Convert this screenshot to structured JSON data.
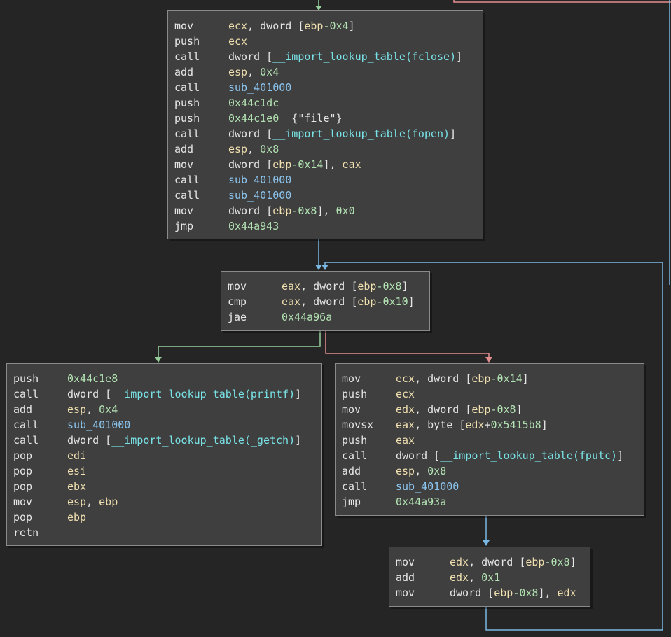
{
  "colors": {
    "background": "#252525",
    "block_bg": "#3f3f3f",
    "block_border": "#8a8a8a",
    "edge_unconditional": "#7ab8e4",
    "edge_true": "#97d09d",
    "edge_false": "#e48f8f",
    "register": "#f0dfaf",
    "number": "#b3e3b3",
    "symbol": "#79e2e6",
    "subroutine": "#8cc6f0"
  },
  "blocks": [
    {
      "id": "block_file_setup",
      "lines": [
        {
          "mnemonic": "mov",
          "operands": [
            [
              "ecx",
              "reg"
            ],
            [
              ", dword [",
              "txt"
            ],
            [
              "ebp",
              "reg"
            ],
            [
              "-0x4",
              "num"
            ],
            [
              "]",
              "txt"
            ]
          ]
        },
        {
          "mnemonic": "push",
          "operands": [
            [
              "ecx",
              "reg"
            ]
          ]
        },
        {
          "mnemonic": "call",
          "operands": [
            [
              "dword [",
              "txt"
            ],
            [
              "__import_lookup_table(fclose)",
              "sym"
            ],
            [
              "]",
              "txt"
            ]
          ]
        },
        {
          "mnemonic": "add",
          "operands": [
            [
              "esp",
              "reg"
            ],
            [
              ", ",
              "txt"
            ],
            [
              "0x4",
              "num"
            ]
          ]
        },
        {
          "mnemonic": "call",
          "operands": [
            [
              "sub_401000",
              "sub"
            ]
          ]
        },
        {
          "mnemonic": "push",
          "operands": [
            [
              "0x44c1dc",
              "num"
            ]
          ]
        },
        {
          "mnemonic": "push",
          "operands": [
            [
              "0x44c1e0",
              "num"
            ],
            [
              "  {\"file\"}",
              "txt"
            ]
          ]
        },
        {
          "mnemonic": "call",
          "operands": [
            [
              "dword [",
              "txt"
            ],
            [
              "__import_lookup_table(fopen)",
              "sym"
            ],
            [
              "]",
              "txt"
            ]
          ]
        },
        {
          "mnemonic": "add",
          "operands": [
            [
              "esp",
              "reg"
            ],
            [
              ", ",
              "txt"
            ],
            [
              "0x8",
              "num"
            ]
          ]
        },
        {
          "mnemonic": "mov",
          "operands": [
            [
              "dword [",
              "txt"
            ],
            [
              "ebp",
              "reg"
            ],
            [
              "-0x14",
              "num"
            ],
            [
              "], ",
              "txt"
            ],
            [
              "eax",
              "reg"
            ]
          ]
        },
        {
          "mnemonic": "call",
          "operands": [
            [
              "sub_401000",
              "sub"
            ]
          ]
        },
        {
          "mnemonic": "call",
          "operands": [
            [
              "sub_401000",
              "sub"
            ]
          ]
        },
        {
          "mnemonic": "mov",
          "operands": [
            [
              "dword [",
              "txt"
            ],
            [
              "ebp",
              "reg"
            ],
            [
              "-0x8",
              "num"
            ],
            [
              "], ",
              "txt"
            ],
            [
              "0x0",
              "num"
            ]
          ]
        },
        {
          "mnemonic": "jmp",
          "operands": [
            [
              "0x44a943",
              "num"
            ]
          ]
        }
      ]
    },
    {
      "id": "block_loop_cond",
      "lines": [
        {
          "mnemonic": "mov",
          "operands": [
            [
              "eax",
              "reg"
            ],
            [
              ", dword [",
              "txt"
            ],
            [
              "ebp",
              "reg"
            ],
            [
              "-0x8",
              "num"
            ],
            [
              "]",
              "txt"
            ]
          ]
        },
        {
          "mnemonic": "cmp",
          "operands": [
            [
              "eax",
              "reg"
            ],
            [
              ", dword [",
              "txt"
            ],
            [
              "ebp",
              "reg"
            ],
            [
              "-0x10",
              "num"
            ],
            [
              "]",
              "txt"
            ]
          ]
        },
        {
          "mnemonic": "jae",
          "operands": [
            [
              "0x44a96a",
              "num"
            ]
          ]
        }
      ]
    },
    {
      "id": "block_exit",
      "lines": [
        {
          "mnemonic": "push",
          "operands": [
            [
              "0x44c1e8",
              "num"
            ]
          ]
        },
        {
          "mnemonic": "call",
          "operands": [
            [
              "dword [",
              "txt"
            ],
            [
              "__import_lookup_table(printf)",
              "sym"
            ],
            [
              "]",
              "txt"
            ]
          ]
        },
        {
          "mnemonic": "add",
          "operands": [
            [
              "esp",
              "reg"
            ],
            [
              ", ",
              "txt"
            ],
            [
              "0x4",
              "num"
            ]
          ]
        },
        {
          "mnemonic": "call",
          "operands": [
            [
              "sub_401000",
              "sub"
            ]
          ]
        },
        {
          "mnemonic": "call",
          "operands": [
            [
              "dword [",
              "txt"
            ],
            [
              "__import_lookup_table(_getch)",
              "sym"
            ],
            [
              "]",
              "txt"
            ]
          ]
        },
        {
          "mnemonic": "pop",
          "operands": [
            [
              "edi",
              "reg"
            ]
          ]
        },
        {
          "mnemonic": "pop",
          "operands": [
            [
              "esi",
              "reg"
            ]
          ]
        },
        {
          "mnemonic": "pop",
          "operands": [
            [
              "ebx",
              "reg"
            ]
          ]
        },
        {
          "mnemonic": "mov",
          "operands": [
            [
              "esp",
              "reg"
            ],
            [
              ", ",
              "txt"
            ],
            [
              "ebp",
              "reg"
            ]
          ]
        },
        {
          "mnemonic": "pop",
          "operands": [
            [
              "ebp",
              "reg"
            ]
          ]
        },
        {
          "mnemonic": "retn",
          "operands": []
        }
      ]
    },
    {
      "id": "block_loop_body",
      "lines": [
        {
          "mnemonic": "mov",
          "operands": [
            [
              "ecx",
              "reg"
            ],
            [
              ", dword [",
              "txt"
            ],
            [
              "ebp",
              "reg"
            ],
            [
              "-0x14",
              "num"
            ],
            [
              "]",
              "txt"
            ]
          ]
        },
        {
          "mnemonic": "push",
          "operands": [
            [
              "ecx",
              "reg"
            ]
          ]
        },
        {
          "mnemonic": "mov",
          "operands": [
            [
              "edx",
              "reg"
            ],
            [
              ", dword [",
              "txt"
            ],
            [
              "ebp",
              "reg"
            ],
            [
              "-0x8",
              "num"
            ],
            [
              "]",
              "txt"
            ]
          ]
        },
        {
          "mnemonic": "movsx",
          "operands": [
            [
              "eax",
              "reg"
            ],
            [
              ", byte [",
              "txt"
            ],
            [
              "edx",
              "reg"
            ],
            [
              "+",
              "txt"
            ],
            [
              "0x5415b8",
              "num"
            ],
            [
              "]",
              "txt"
            ]
          ]
        },
        {
          "mnemonic": "push",
          "operands": [
            [
              "eax",
              "reg"
            ]
          ]
        },
        {
          "mnemonic": "call",
          "operands": [
            [
              "dword [",
              "txt"
            ],
            [
              "__import_lookup_table(fputc)",
              "sym"
            ],
            [
              "]",
              "txt"
            ]
          ]
        },
        {
          "mnemonic": "add",
          "operands": [
            [
              "esp",
              "reg"
            ],
            [
              ", ",
              "txt"
            ],
            [
              "0x8",
              "num"
            ]
          ]
        },
        {
          "mnemonic": "call",
          "operands": [
            [
              "sub_401000",
              "sub"
            ]
          ]
        },
        {
          "mnemonic": "jmp",
          "operands": [
            [
              "0x44a93a",
              "num"
            ]
          ]
        }
      ]
    },
    {
      "id": "block_increment",
      "lines": [
        {
          "mnemonic": "mov",
          "operands": [
            [
              "edx",
              "reg"
            ],
            [
              ", dword [",
              "txt"
            ],
            [
              "ebp",
              "reg"
            ],
            [
              "-0x8",
              "num"
            ],
            [
              "]",
              "txt"
            ]
          ]
        },
        {
          "mnemonic": "add",
          "operands": [
            [
              "edx",
              "reg"
            ],
            [
              ", ",
              "txt"
            ],
            [
              "0x1",
              "num"
            ]
          ]
        },
        {
          "mnemonic": "mov",
          "operands": [
            [
              "dword [",
              "txt"
            ],
            [
              "ebp",
              "reg"
            ],
            [
              "-0x8",
              "num"
            ],
            [
              "], ",
              "txt"
            ],
            [
              "edx",
              "reg"
            ]
          ]
        }
      ]
    }
  ]
}
